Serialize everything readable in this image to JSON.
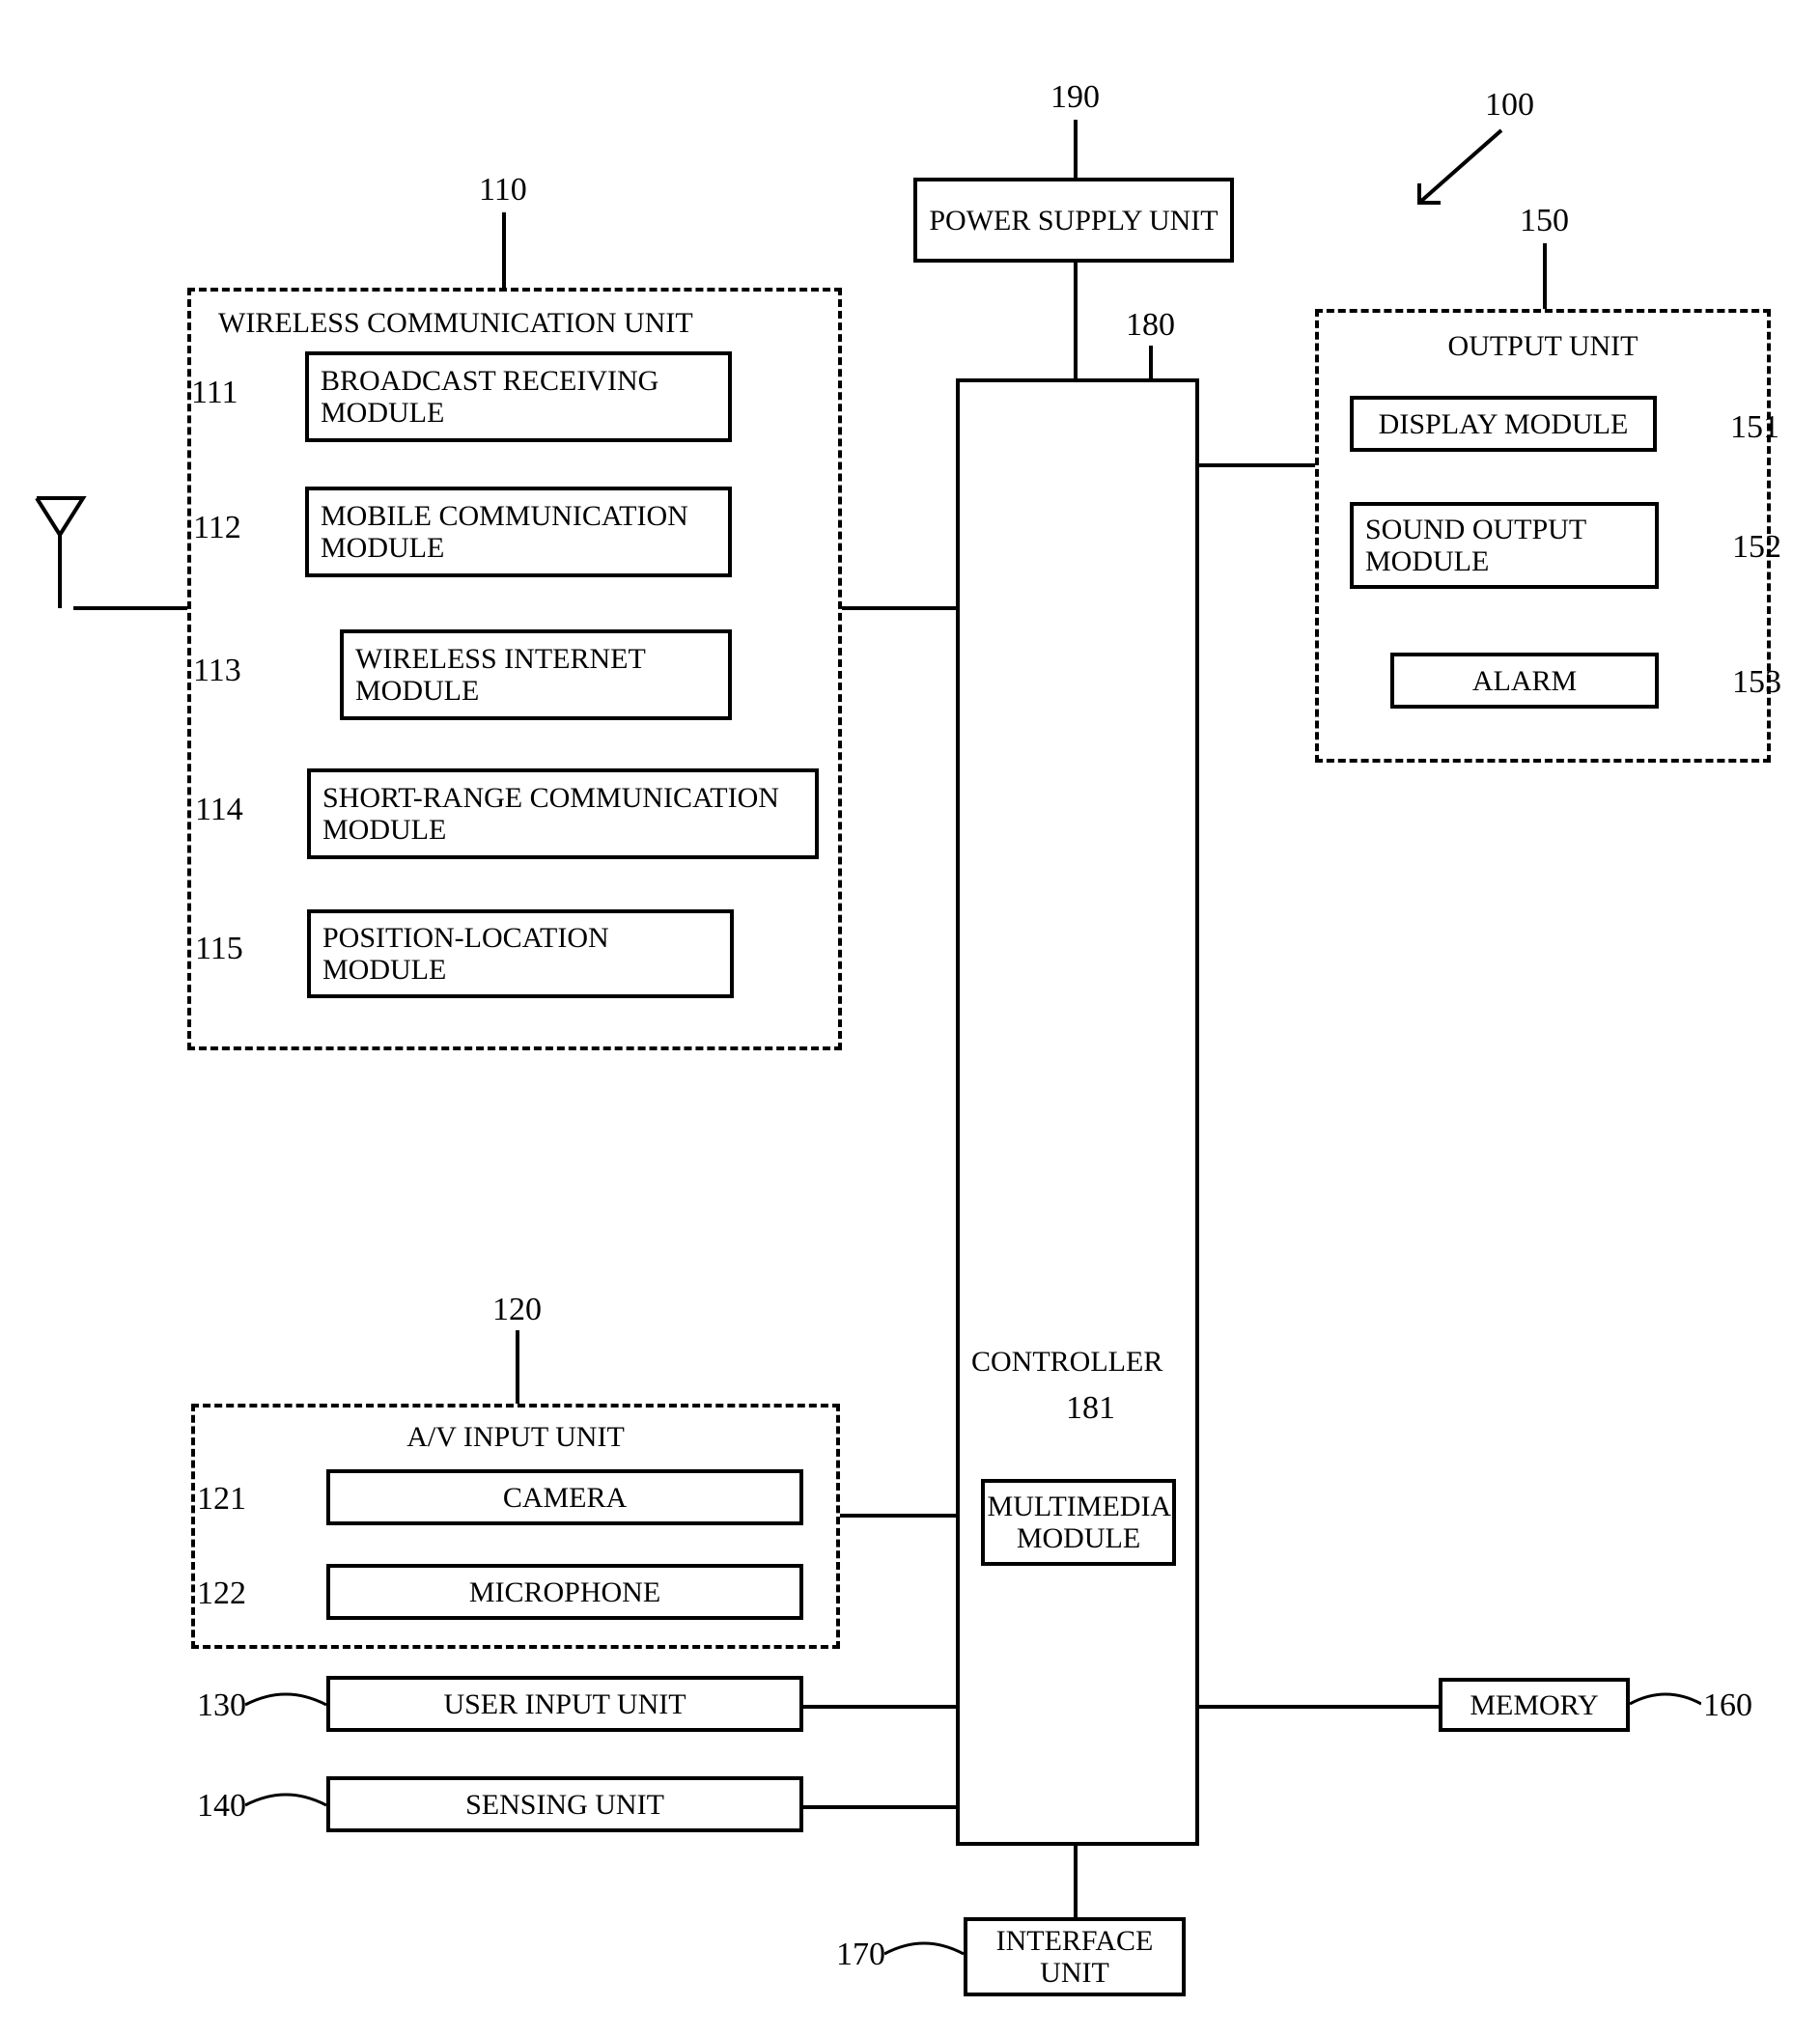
{
  "refs": {
    "r100": "100",
    "r110": "110",
    "r111": "111",
    "r112": "112",
    "r113": "113",
    "r114": "114",
    "r115": "115",
    "r120": "120",
    "r121": "121",
    "r122": "122",
    "r130": "130",
    "r140": "140",
    "r150": "150",
    "r151": "151",
    "r152": "152",
    "r153": "153",
    "r160": "160",
    "r170": "170",
    "r180": "180",
    "r181": "181",
    "r190": "190"
  },
  "labels": {
    "power_supply_unit": "POWER SUPPLY UNIT",
    "wireless_comm_unit": "WIRELESS COMMUNICATION UNIT",
    "broadcast_receiving": "BROADCAST RECEIVING MODULE",
    "mobile_comm": "MOBILE COMMUNICATION MODULE",
    "wireless_internet": "WIRELESS INTERNET MODULE",
    "short_range": "SHORT-RANGE COMMUNICATION MODULE",
    "position_loc": "POSITION-LOCATION MODULE",
    "av_input": "A/V INPUT UNIT",
    "camera": "CAMERA",
    "microphone": "MICROPHONE",
    "user_input": "USER INPUT UNIT",
    "sensing": "SENSING UNIT",
    "controller": "CONTROLLER",
    "multimedia": "MULTIMEDIA MODULE",
    "output_unit": "OUTPUT UNIT",
    "display": "DISPLAY MODULE",
    "sound_output": "SOUND OUTPUT MODULE",
    "alarm": "ALARM",
    "memory": "MEMORY",
    "interface": "INTERFACE UNIT"
  }
}
